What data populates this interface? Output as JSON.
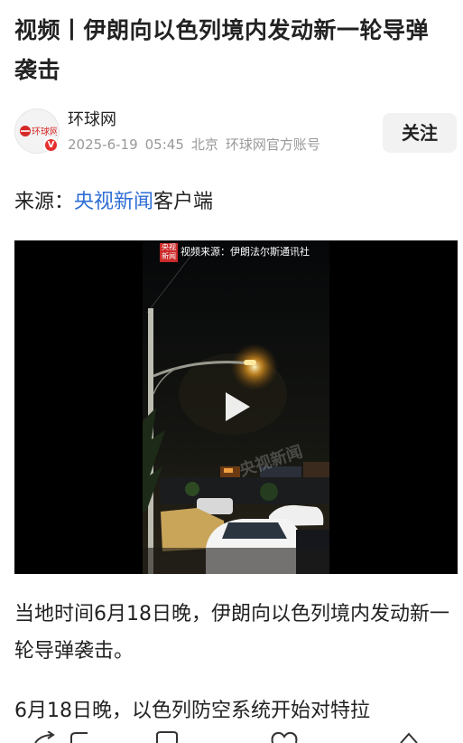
{
  "article": {
    "title": "视频丨伊朗向以色列境内发动新一轮导弹袭击"
  },
  "author": {
    "name": "环球网",
    "avatar_logo_text": "环球网",
    "verified_icon": "verified-v-icon",
    "date": "2025-6-19",
    "time": "05:45",
    "location": "北京",
    "account_type": "环球网官方账号",
    "follow_label": "关注"
  },
  "source": {
    "prefix": "来源：",
    "link_text": "央视新闻",
    "suffix": "客户端"
  },
  "video": {
    "caption": "视频来源：伊朗法尔斯通讯社",
    "logo_text": "央视新闻",
    "watermark": "央视新闻",
    "play_icon": "play-icon"
  },
  "body": {
    "paragraph_1": "当地时间6月18日晚，伊朗向以色列境内发动新一轮导弹袭击。",
    "paragraph_2": "6月18日晚，以色列防空系统开始对特拉"
  },
  "colors": {
    "link": "#2e6ed6",
    "brand_red": "#e5302d",
    "meta_gray": "#999999"
  }
}
